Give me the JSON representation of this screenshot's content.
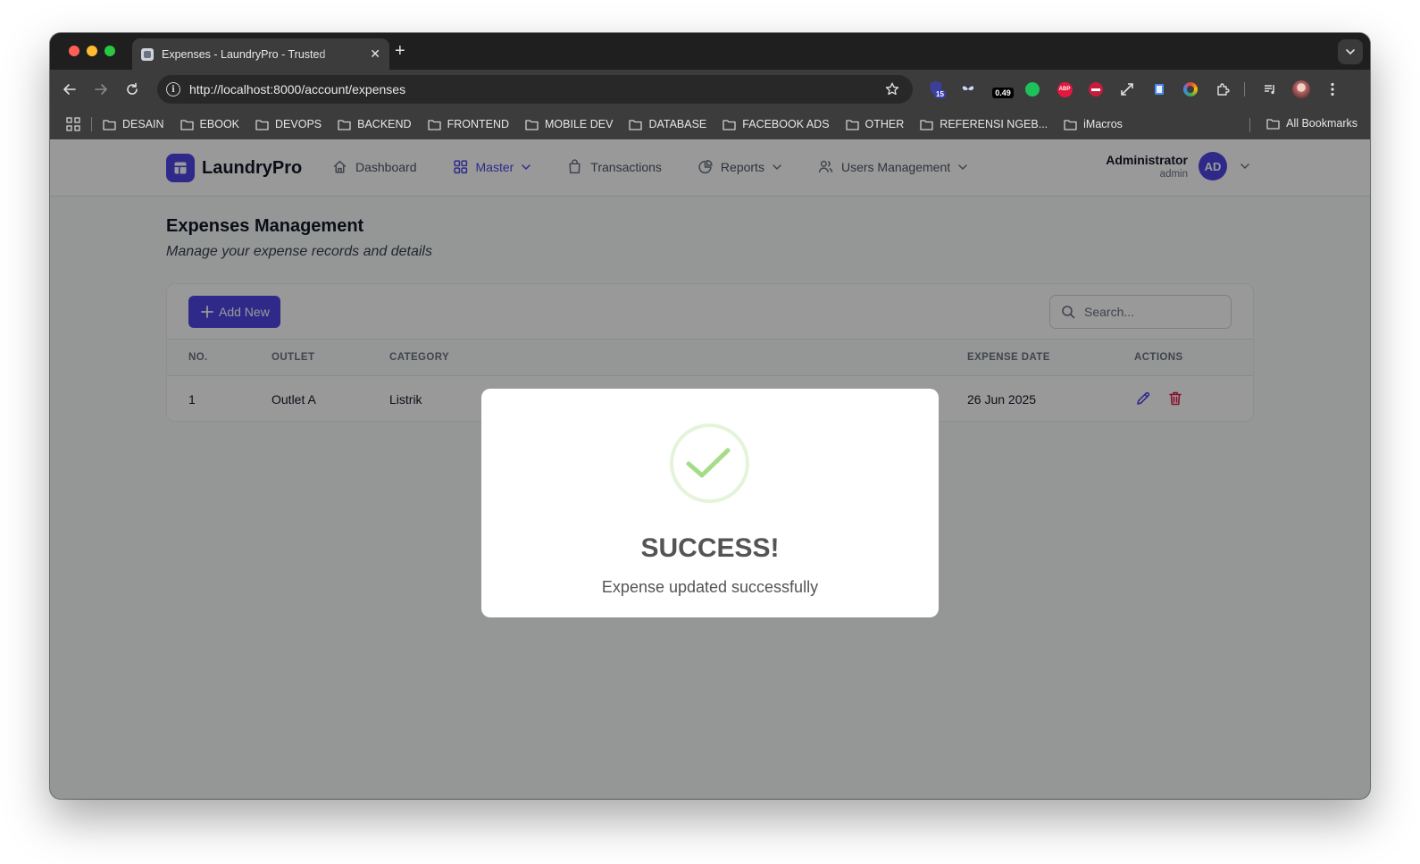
{
  "browser": {
    "tab_title": "Expenses - LaundryPro - Trusted",
    "url_prefix": "http://",
    "url_host": "localhost",
    "url_rest": ":8000/account/expenses",
    "extensions": [
      {
        "name": "badge-15",
        "label": "15"
      },
      {
        "name": "speed-readout",
        "label": "0.49"
      }
    ],
    "bookmarks": [
      "DESAIN",
      "EBOOK",
      "DEVOPS",
      "BACKEND",
      "FRONTEND",
      "MOBILE DEV",
      "DATABASE",
      "FACEBOOK ADS",
      "OTHER",
      "REFERENSI NGEB...",
      "iMacros"
    ],
    "all_bookmarks": "All Bookmarks"
  },
  "app": {
    "brand": "LaundryPro",
    "nav": [
      {
        "label": "Dashboard",
        "icon": "home-icon",
        "active": false,
        "dropdown": false
      },
      {
        "label": "Master",
        "icon": "grid-icon",
        "active": true,
        "dropdown": true
      },
      {
        "label": "Transactions",
        "icon": "bag-icon",
        "active": false,
        "dropdown": false
      },
      {
        "label": "Reports",
        "icon": "pie-chart-icon",
        "active": false,
        "dropdown": true
      },
      {
        "label": "Users Management",
        "icon": "users-icon",
        "active": false,
        "dropdown": true
      }
    ],
    "user": {
      "name": "Administrator",
      "role": "admin",
      "initials": "AD"
    }
  },
  "page": {
    "title": "Expenses Management",
    "subtitle": "Manage your expense records and details",
    "add_button": "Add New",
    "search_placeholder": "Search...",
    "columns": [
      "NO.",
      "OUTLET",
      "CATEGORY",
      "EXPENSE DATE",
      "ACTIONS"
    ],
    "rows": [
      {
        "no": "1",
        "outlet": "Outlet A",
        "category": "Listrik",
        "expense_date": "26 Jun 2025"
      }
    ]
  },
  "modal": {
    "title": "SUCCESS!",
    "message": "Expense updated successfully"
  },
  "colors": {
    "accent": "#4f46e5",
    "success": "#a5dc86",
    "delete": "#e11d48"
  }
}
